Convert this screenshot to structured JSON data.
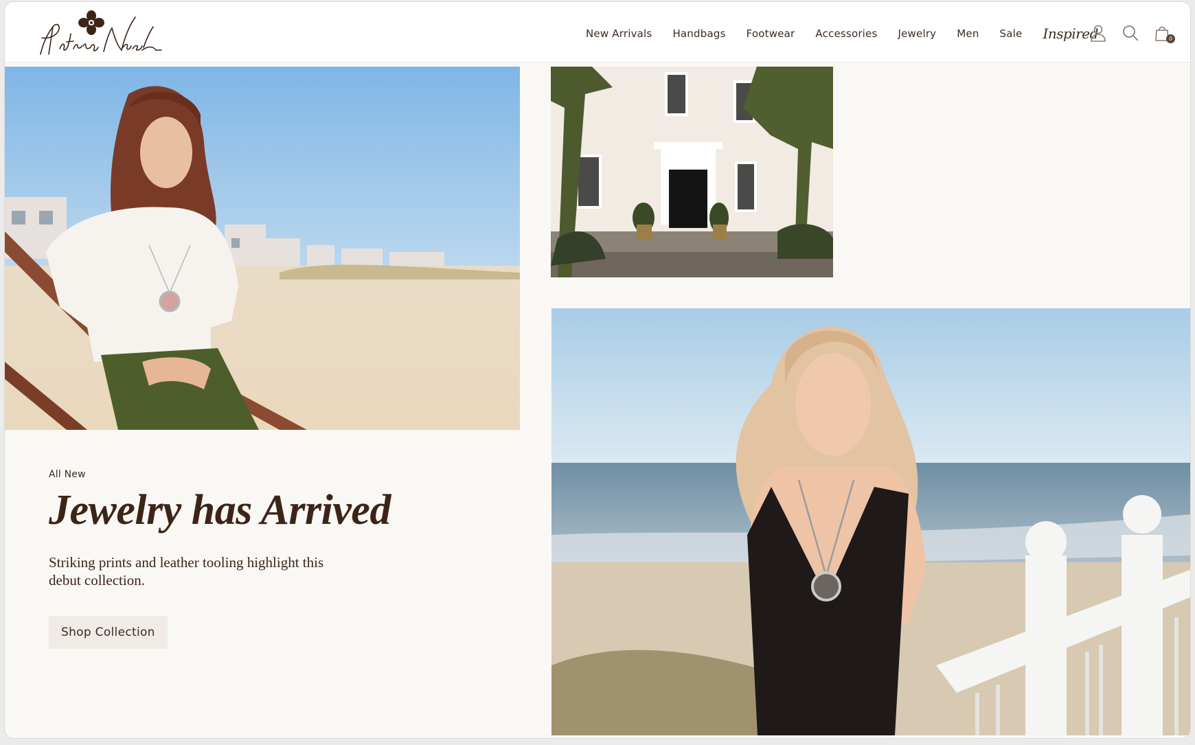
{
  "brand": {
    "logo_text": "Patricia Nash",
    "logo_icon": "flower-logo-icon"
  },
  "nav": {
    "items": [
      {
        "label": "New Arrivals"
      },
      {
        "label": "Handbags"
      },
      {
        "label": "Footwear"
      },
      {
        "label": "Accessories"
      },
      {
        "label": "Jewelry"
      },
      {
        "label": "Men"
      },
      {
        "label": "Sale"
      }
    ],
    "inspired_label": "Inspired"
  },
  "header_icons": {
    "account": "user-icon",
    "search": "search-icon",
    "cart": "shopping-bag-icon",
    "cart_count": "0"
  },
  "promo": {
    "eyebrow": "All New",
    "headline": "Jewelry has Arrived",
    "subtext": "Striking prints and leather tooling highlight this debut collection.",
    "cta_label": "Shop Collection"
  },
  "colors": {
    "page_bg": "#f9f8f4",
    "header_bg": "#ffffff",
    "text_dark": "#3d2418",
    "cta_bg": "#f1ebe5"
  }
}
